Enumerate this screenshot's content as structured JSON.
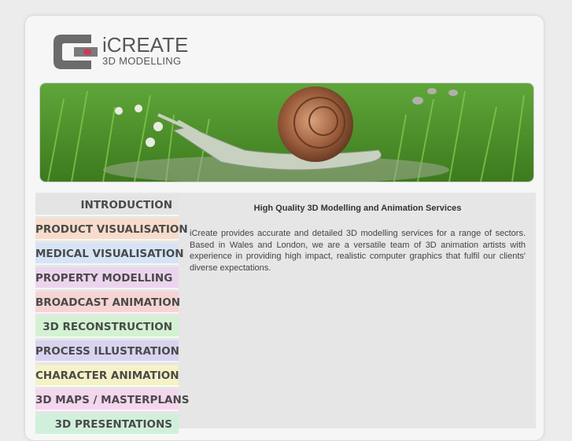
{
  "brand": {
    "title": "iCREATE",
    "subtitle": "3D MODELLING"
  },
  "banner": {
    "alt": "Snail in grass"
  },
  "nav": {
    "items": [
      {
        "label": "INTRODUCTION",
        "color": "#e4e4e4"
      },
      {
        "label": "PRODUCT VISUALISATION",
        "color": "#f7dccb"
      },
      {
        "label": "MEDICAL VISUALISATION",
        "color": "#d6e4f6"
      },
      {
        "label": "PROPERTY MODELLING",
        "color": "#ecd4ee"
      },
      {
        "label": "BROADCAST ANIMATION",
        "color": "#f6d4d4"
      },
      {
        "label": "3D RECONSTRUCTION",
        "color": "#d2f2d2"
      },
      {
        "label": "PROCESS ILLUSTRATION",
        "color": "#d8d4f0"
      },
      {
        "label": "CHARACTER ANIMATION",
        "color": "#f4f2c6"
      },
      {
        "label": "3D MAPS / MASTERPLANS",
        "color": "#f4d6ee"
      },
      {
        "label": "3D PRESENTATIONS",
        "color": "#d0f0dc"
      }
    ]
  },
  "main": {
    "heading": "High Quality 3D Modelling and Animation Services",
    "paragraph": "iCreate provides accurate and detailed 3D modelling services for a range of sectors. Based in Wales and London, we are a versatile team of 3D animation artists with experience in providing high impact, realistic computer graphics that fulfil our clients' diverse expectations."
  }
}
